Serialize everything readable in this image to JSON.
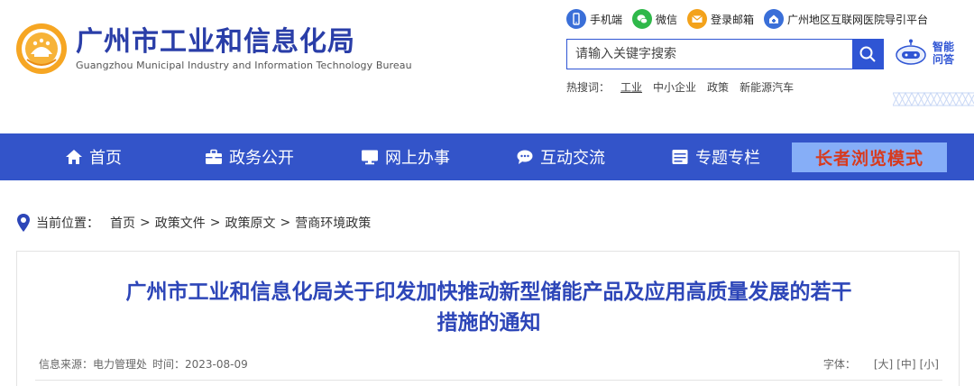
{
  "header": {
    "site_name_cn": "广州市工业和信息化局",
    "site_name_en": "Guangzhou Municipal Industry and Information Technology Bureau",
    "top_links": [
      {
        "label": "手机端",
        "icon": "mobile-icon",
        "color": "#3a6fd8"
      },
      {
        "label": "微信",
        "icon": "wechat-icon",
        "color": "#2fb84a"
      },
      {
        "label": "登录邮箱",
        "icon": "mail-icon",
        "color": "#f3a21b"
      },
      {
        "label": "广州地区互联网医院导引平台",
        "icon": "hospital-icon",
        "color": "#3a6fd8"
      }
    ],
    "search": {
      "placeholder": "请输入关键字搜索"
    },
    "ai_assistant": {
      "label": "智能问答"
    },
    "hot_search": {
      "label": "热搜词：",
      "keywords": [
        "工业",
        "中小企业",
        "政策",
        "新能源汽车"
      ]
    }
  },
  "nav": {
    "items": [
      {
        "label": "首页",
        "icon": "home-icon"
      },
      {
        "label": "政务公开",
        "icon": "briefcase-icon"
      },
      {
        "label": "网上办事",
        "icon": "monitor-icon"
      },
      {
        "label": "互动交流",
        "icon": "chat-icon"
      },
      {
        "label": "专题专栏",
        "icon": "window-icon"
      }
    ],
    "elder_mode": "长者浏览模式"
  },
  "breadcrumb": {
    "label": "当前位置：",
    "items": [
      "首页",
      "政策文件",
      "政策原文",
      "营商环境政策"
    ],
    "separator": ">"
  },
  "article": {
    "title_line1": "广州市工业和信息化局关于印发加快推动新型储能产品及应用高质量发展的若干",
    "title_line2": "措施的通知",
    "source": "信息来源：电力管理处",
    "time": "时间：2023-08-09",
    "font_label": "字体：",
    "font_sizes": [
      "[大]",
      "[中]",
      "[小]"
    ]
  },
  "colors": {
    "primary": "#3354c9",
    "title": "#2d46b8",
    "elder_bg": "#86aef7",
    "elder_text": "#d73a1e"
  }
}
